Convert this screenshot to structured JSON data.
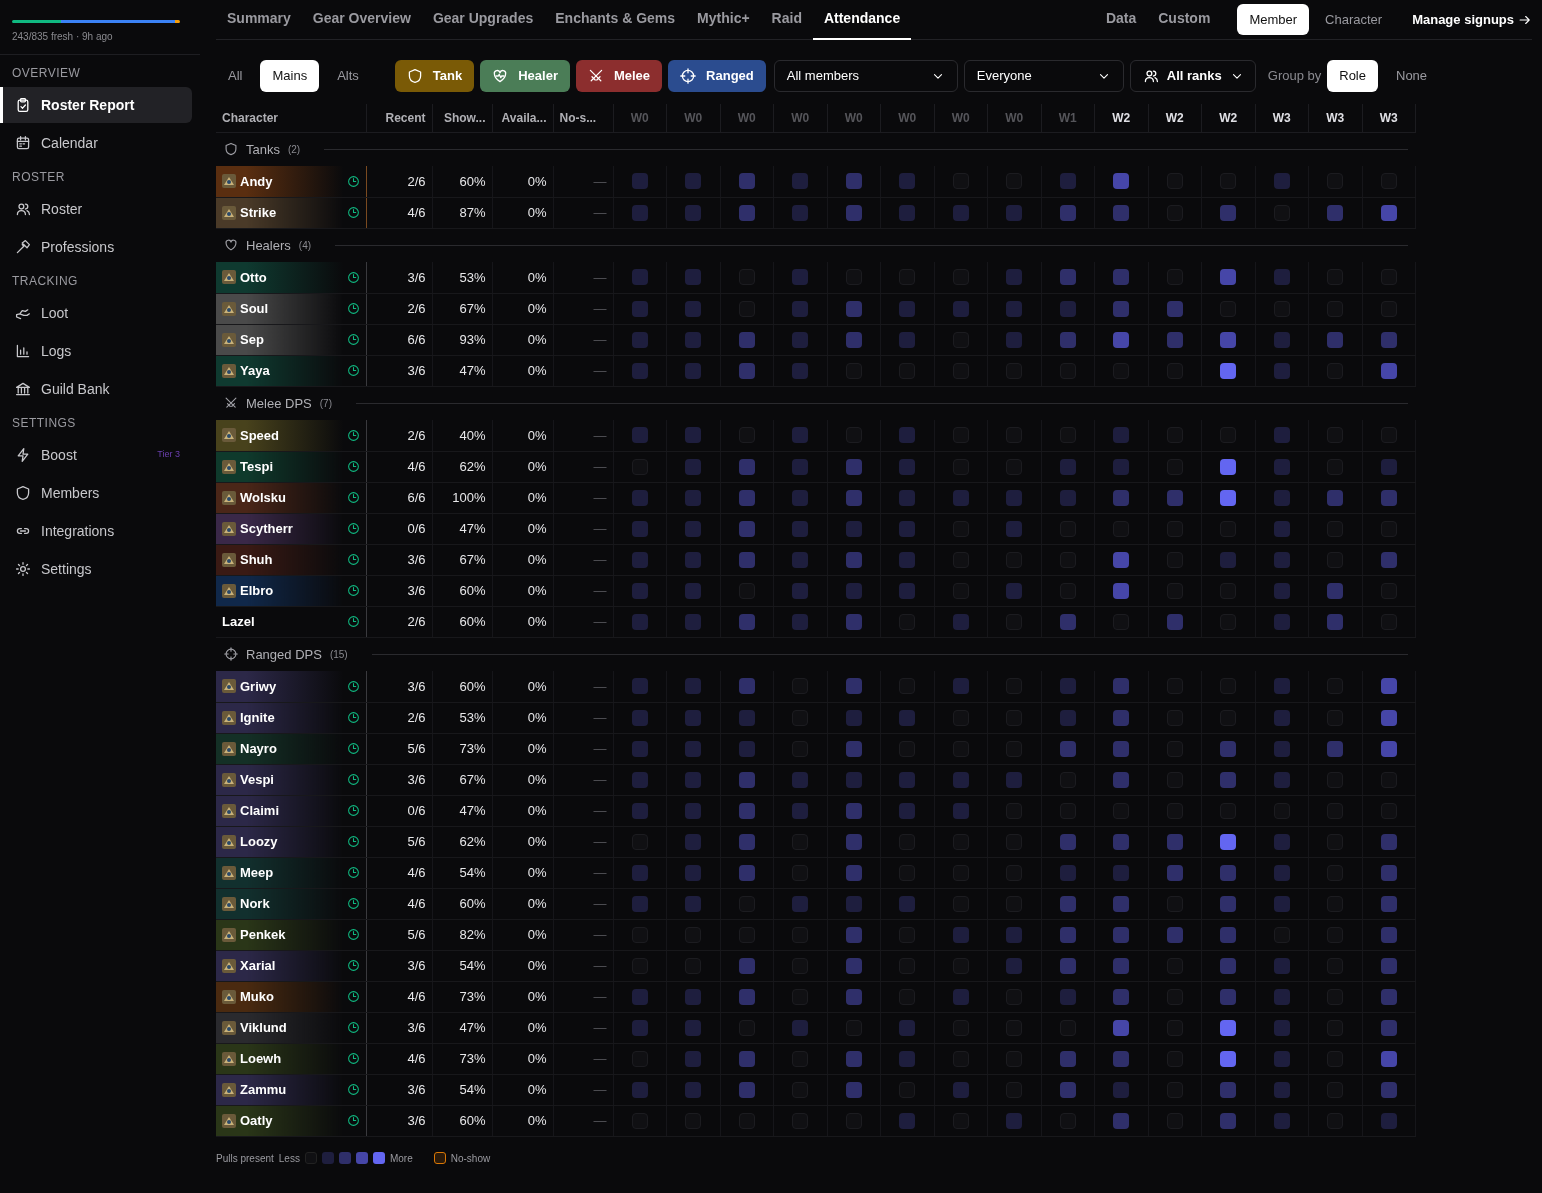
{
  "sidebar": {
    "freshness": {
      "segments": [
        {
          "level": 0.29,
          "color": "#10b981"
        },
        {
          "level": 0.68,
          "color": "#3b82f6"
        },
        {
          "level": 0.03,
          "color": "#f59e0b"
        }
      ],
      "text": "243/835 fresh · 9h ago"
    },
    "sections": [
      {
        "title": "OVERVIEW",
        "items": [
          {
            "label": "Roster Report",
            "selected": true
          },
          {
            "label": "Calendar",
            "selected": false
          }
        ]
      },
      {
        "title": "ROSTER",
        "items": [
          {
            "label": "Roster",
            "selected": false
          },
          {
            "label": "Professions",
            "selected": false
          }
        ]
      },
      {
        "title": "TRACKING",
        "items": [
          {
            "label": "Loot",
            "selected": false
          },
          {
            "label": "Logs",
            "selected": false
          },
          {
            "label": "Guild Bank",
            "selected": false
          }
        ]
      },
      {
        "title": "SETTINGS",
        "items": [
          {
            "label": "Boost",
            "selected": false,
            "badge": "Tier 3"
          },
          {
            "label": "Members",
            "selected": false
          },
          {
            "label": "Integrations",
            "selected": false
          },
          {
            "label": "Settings",
            "selected": false
          }
        ]
      }
    ]
  },
  "tabs": [
    {
      "label": "Summary",
      "selected": false
    },
    {
      "label": "Gear Overview",
      "selected": false
    },
    {
      "label": "Gear Upgrades",
      "selected": false
    },
    {
      "label": "Enchants & Gems",
      "selected": false
    },
    {
      "label": "Mythic+",
      "selected": false
    },
    {
      "label": "Raid",
      "selected": false
    },
    {
      "label": "Attendance",
      "selected": true
    },
    {
      "label": "Data",
      "selected": false
    },
    {
      "label": "Custom",
      "selected": false
    }
  ],
  "view_toggle": [
    {
      "label": "Member",
      "selected": true
    },
    {
      "label": "Character",
      "selected": false
    }
  ],
  "manage_link": "Manage signups",
  "filters": {
    "scope": [
      {
        "label": "All",
        "selected": false
      },
      {
        "label": "Mains",
        "selected": true
      },
      {
        "label": "Alts",
        "selected": false
      }
    ],
    "roles": [
      {
        "label": "Tank",
        "on": true,
        "color": "#7a5a06"
      },
      {
        "label": "Healer",
        "on": true,
        "color": "#4b7d57"
      },
      {
        "label": "Melee",
        "on": true,
        "color": "#8c2e2e"
      },
      {
        "label": "Ranged",
        "on": true,
        "color": "#2b4c8f"
      }
    ],
    "selects": [
      {
        "value": "All members",
        "kind": "plain"
      },
      {
        "value": "Everyone",
        "kind": "plain"
      },
      {
        "value": "All ranks",
        "kind": "people"
      }
    ],
    "group_by_label": "Group by",
    "group_by": [
      {
        "label": "Role",
        "selected": true
      },
      {
        "label": "None",
        "selected": false
      }
    ]
  },
  "table": {
    "columns": [
      "Character",
      "Recent",
      "Show...",
      "Availa...",
      "No-s..."
    ],
    "weeks": [
      {
        "label": "W0",
        "dimmed": true
      },
      {
        "label": "W0",
        "dimmed": true
      },
      {
        "label": "W0",
        "dimmed": true
      },
      {
        "label": "W0",
        "dimmed": true
      },
      {
        "label": "W0",
        "dimmed": true
      },
      {
        "label": "W0",
        "dimmed": true
      },
      {
        "label": "W0",
        "dimmed": true
      },
      {
        "label": "W0",
        "dimmed": true
      },
      {
        "label": "W1",
        "dimmed": true
      },
      {
        "label": "W2",
        "dimmed": false
      },
      {
        "label": "W2",
        "dimmed": false
      },
      {
        "label": "W2",
        "dimmed": false
      },
      {
        "label": "W3",
        "dimmed": false
      },
      {
        "label": "W3",
        "dimmed": false
      },
      {
        "label": "W3",
        "dimmed": false
      }
    ],
    "groups": [
      {
        "kind": "tank",
        "title": "Tanks",
        "count": "(2)",
        "rows": [
          {
            "name": "Andy",
            "color": "#5a2e10",
            "has_icon": true,
            "recent": "2/6",
            "show": "60%",
            "avail": "0%",
            "noshow": "—",
            "cells": [
              {
                "kind": "low"
              },
              {
                "kind": "low"
              },
              {
                "kind": "mid"
              },
              {
                "kind": "low"
              },
              {
                "kind": "mid"
              },
              {
                "kind": "low"
              },
              {
                "kind": "none"
              },
              {
                "kind": "none"
              },
              {
                "kind": "low"
              },
              {
                "kind": "high"
              },
              {
                "kind": "none"
              },
              {
                "kind": "none"
              },
              {
                "kind": "low"
              },
              {
                "kind": "none"
              },
              {
                "kind": "none"
              }
            ]
          },
          {
            "name": "Strike",
            "color": "#4a3a28",
            "has_icon": true,
            "recent": "4/6",
            "show": "87%",
            "avail": "0%",
            "noshow": "—",
            "cells": [
              {
                "kind": "low"
              },
              {
                "kind": "low"
              },
              {
                "kind": "mid"
              },
              {
                "kind": "low"
              },
              {
                "kind": "mid"
              },
              {
                "kind": "low"
              },
              {
                "kind": "low"
              },
              {
                "kind": "low"
              },
              {
                "kind": "mid"
              },
              {
                "kind": "mid"
              },
              {
                "kind": "none"
              },
              {
                "kind": "mid"
              },
              {
                "kind": "none"
              },
              {
                "kind": "mid"
              },
              {
                "kind": "high"
              }
            ]
          }
        ]
      },
      {
        "kind": "healer",
        "title": "Healers",
        "count": "(4)",
        "rows": [
          {
            "name": "Otto",
            "color": "#0f3a30",
            "has_icon": true,
            "recent": "3/6",
            "show": "53%",
            "avail": "0%",
            "noshow": "—",
            "cells": [
              {
                "kind": "low"
              },
              {
                "kind": "low"
              },
              {
                "kind": "none"
              },
              {
                "kind": "low"
              },
              {
                "kind": "none"
              },
              {
                "kind": "none"
              },
              {
                "kind": "none"
              },
              {
                "kind": "low"
              },
              {
                "kind": "mid"
              },
              {
                "kind": "mid"
              },
              {
                "kind": "none"
              },
              {
                "kind": "high"
              },
              {
                "kind": "low"
              },
              {
                "kind": "none"
              },
              {
                "kind": "none"
              }
            ]
          },
          {
            "name": "Soul",
            "color": "#4a4a4a",
            "has_icon": true,
            "recent": "2/6",
            "show": "67%",
            "avail": "0%",
            "noshow": "—",
            "cells": [
              {
                "kind": "low"
              },
              {
                "kind": "low"
              },
              {
                "kind": "none"
              },
              {
                "kind": "low"
              },
              {
                "kind": "mid"
              },
              {
                "kind": "low"
              },
              {
                "kind": "low"
              },
              {
                "kind": "low"
              },
              {
                "kind": "low"
              },
              {
                "kind": "mid"
              },
              {
                "kind": "mid"
              },
              {
                "kind": "none"
              },
              {
                "kind": "none"
              },
              {
                "kind": "none"
              },
              {
                "kind": "none"
              }
            ]
          },
          {
            "name": "Sep",
            "color": "#4a4a4a",
            "has_icon": true,
            "recent": "6/6",
            "show": "93%",
            "avail": "0%",
            "noshow": "—",
            "cells": [
              {
                "kind": "low"
              },
              {
                "kind": "low"
              },
              {
                "kind": "mid"
              },
              {
                "kind": "low"
              },
              {
                "kind": "mid"
              },
              {
                "kind": "low"
              },
              {
                "kind": "none"
              },
              {
                "kind": "low"
              },
              {
                "kind": "mid"
              },
              {
                "kind": "high"
              },
              {
                "kind": "mid"
              },
              {
                "kind": "high"
              },
              {
                "kind": "low"
              },
              {
                "kind": "mid"
              },
              {
                "kind": "mid"
              }
            ]
          },
          {
            "name": "Yaya",
            "color": "#0f3a30",
            "has_icon": true,
            "recent": "3/6",
            "show": "47%",
            "avail": "0%",
            "noshow": "—",
            "cells": [
              {
                "kind": "low"
              },
              {
                "kind": "low"
              },
              {
                "kind": "mid"
              },
              {
                "kind": "low"
              },
              {
                "kind": "none"
              },
              {
                "kind": "none"
              },
              {
                "kind": "none"
              },
              {
                "kind": "none"
              },
              {
                "kind": "none"
              },
              {
                "kind": "none"
              },
              {
                "kind": "none"
              },
              {
                "kind": "max"
              },
              {
                "kind": "low"
              },
              {
                "kind": "none"
              },
              {
                "kind": "high"
              }
            ]
          }
        ]
      },
      {
        "kind": "melee",
        "title": "Melee DPS",
        "count": "(7)",
        "rows": [
          {
            "name": "Speed",
            "color": "#48421c",
            "has_icon": true,
            "recent": "2/6",
            "show": "40%",
            "avail": "0%",
            "noshow": "—",
            "cells": [
              {
                "kind": "low"
              },
              {
                "kind": "low"
              },
              {
                "kind": "none"
              },
              {
                "kind": "low"
              },
              {
                "kind": "none"
              },
              {
                "kind": "low"
              },
              {
                "kind": "none"
              },
              {
                "kind": "none"
              },
              {
                "kind": "none"
              },
              {
                "kind": "low"
              },
              {
                "kind": "none"
              },
              {
                "kind": "none"
              },
              {
                "kind": "low"
              },
              {
                "kind": "none"
              },
              {
                "kind": "none"
              }
            ]
          },
          {
            "name": "Tespi",
            "color": "#0f3a2c",
            "has_icon": true,
            "recent": "4/6",
            "show": "62%",
            "avail": "0%",
            "noshow": "—",
            "cells": [
              {
                "kind": "none"
              },
              {
                "kind": "low"
              },
              {
                "kind": "mid"
              },
              {
                "kind": "low"
              },
              {
                "kind": "mid"
              },
              {
                "kind": "low"
              },
              {
                "kind": "none"
              },
              {
                "kind": "none"
              },
              {
                "kind": "low"
              },
              {
                "kind": "low"
              },
              {
                "kind": "none"
              },
              {
                "kind": "max"
              },
              {
                "kind": "low"
              },
              {
                "kind": "none"
              },
              {
                "kind": "low"
              }
            ]
          },
          {
            "name": "Wolsku",
            "color": "#4a2618",
            "has_icon": true,
            "recent": "6/6",
            "show": "100%",
            "avail": "0%",
            "noshow": "—",
            "cells": [
              {
                "kind": "low"
              },
              {
                "kind": "low"
              },
              {
                "kind": "mid"
              },
              {
                "kind": "low"
              },
              {
                "kind": "mid"
              },
              {
                "kind": "low"
              },
              {
                "kind": "low"
              },
              {
                "kind": "low"
              },
              {
                "kind": "low"
              },
              {
                "kind": "mid"
              },
              {
                "kind": "mid"
              },
              {
                "kind": "max"
              },
              {
                "kind": "low"
              },
              {
                "kind": "mid"
              },
              {
                "kind": "mid"
              }
            ]
          },
          {
            "name": "Scytherr",
            "color": "#3a2848",
            "has_icon": true,
            "recent": "0/6",
            "show": "47%",
            "avail": "0%",
            "noshow": "—",
            "cells": [
              {
                "kind": "low"
              },
              {
                "kind": "low"
              },
              {
                "kind": "mid"
              },
              {
                "kind": "low"
              },
              {
                "kind": "low"
              },
              {
                "kind": "low"
              },
              {
                "kind": "none"
              },
              {
                "kind": "low"
              },
              {
                "kind": "none"
              },
              {
                "kind": "none"
              },
              {
                "kind": "none"
              },
              {
                "kind": "none"
              },
              {
                "kind": "low"
              },
              {
                "kind": "none"
              },
              {
                "kind": "none"
              }
            ]
          },
          {
            "name": "Shuh",
            "color": "#3a1a14",
            "has_icon": true,
            "recent": "3/6",
            "show": "67%",
            "avail": "0%",
            "noshow": "—",
            "cells": [
              {
                "kind": "low"
              },
              {
                "kind": "low"
              },
              {
                "kind": "mid"
              },
              {
                "kind": "low"
              },
              {
                "kind": "mid"
              },
              {
                "kind": "low"
              },
              {
                "kind": "none"
              },
              {
                "kind": "none"
              },
              {
                "kind": "none"
              },
              {
                "kind": "high"
              },
              {
                "kind": "none"
              },
              {
                "kind": "low"
              },
              {
                "kind": "low"
              },
              {
                "kind": "none"
              },
              {
                "kind": "mid"
              }
            ]
          },
          {
            "name": "Elbro",
            "color": "#10284a",
            "has_icon": true,
            "recent": "3/6",
            "show": "60%",
            "avail": "0%",
            "noshow": "—",
            "cells": [
              {
                "kind": "low"
              },
              {
                "kind": "low"
              },
              {
                "kind": "none"
              },
              {
                "kind": "low"
              },
              {
                "kind": "low"
              },
              {
                "kind": "low"
              },
              {
                "kind": "none"
              },
              {
                "kind": "low"
              },
              {
                "kind": "none"
              },
              {
                "kind": "high"
              },
              {
                "kind": "none"
              },
              {
                "kind": "none"
              },
              {
                "kind": "low"
              },
              {
                "kind": "mid"
              },
              {
                "kind": "none"
              }
            ]
          },
          {
            "name": "Lazel",
            "recent": "2/6",
            "show": "60%",
            "avail": "0%",
            "noshow": "—",
            "cells": [
              {
                "kind": "low"
              },
              {
                "kind": "low"
              },
              {
                "kind": "mid"
              },
              {
                "kind": "low"
              },
              {
                "kind": "mid"
              },
              {
                "kind": "none"
              },
              {
                "kind": "low"
              },
              {
                "kind": "none"
              },
              {
                "kind": "mid"
              },
              {
                "kind": "none"
              },
              {
                "kind": "mid"
              },
              {
                "kind": "none"
              },
              {
                "kind": "low"
              },
              {
                "kind": "mid"
              },
              {
                "kind": "none"
              }
            ]
          }
        ]
      },
      {
        "kind": "ranged",
        "title": "Ranged DPS",
        "count": "(15)",
        "rows": [
          {
            "name": "Griwy",
            "color": "#2c2848",
            "has_icon": true,
            "recent": "3/6",
            "show": "60%",
            "avail": "0%",
            "noshow": "—",
            "cells": [
              {
                "kind": "low"
              },
              {
                "kind": "low"
              },
              {
                "kind": "mid"
              },
              {
                "kind": "none"
              },
              {
                "kind": "mid"
              },
              {
                "kind": "none"
              },
              {
                "kind": "low"
              },
              {
                "kind": "none"
              },
              {
                "kind": "low"
              },
              {
                "kind": "mid"
              },
              {
                "kind": "none"
              },
              {
                "kind": "none"
              },
              {
                "kind": "low"
              },
              {
                "kind": "none"
              },
              {
                "kind": "high"
              }
            ]
          },
          {
            "name": "Ignite",
            "color": "#2c2848",
            "has_icon": true,
            "recent": "2/6",
            "show": "53%",
            "avail": "0%",
            "noshow": "—",
            "cells": [
              {
                "kind": "low"
              },
              {
                "kind": "low"
              },
              {
                "kind": "low"
              },
              {
                "kind": "none"
              },
              {
                "kind": "low"
              },
              {
                "kind": "low"
              },
              {
                "kind": "none"
              },
              {
                "kind": "none"
              },
              {
                "kind": "low"
              },
              {
                "kind": "mid"
              },
              {
                "kind": "none"
              },
              {
                "kind": "none"
              },
              {
                "kind": "low"
              },
              {
                "kind": "none"
              },
              {
                "kind": "high"
              }
            ]
          },
          {
            "name": "Nayro",
            "color": "#143026",
            "has_icon": true,
            "recent": "5/6",
            "show": "73%",
            "avail": "0%",
            "noshow": "—",
            "cells": [
              {
                "kind": "low"
              },
              {
                "kind": "low"
              },
              {
                "kind": "low"
              },
              {
                "kind": "none"
              },
              {
                "kind": "mid"
              },
              {
                "kind": "none"
              },
              {
                "kind": "none"
              },
              {
                "kind": "none"
              },
              {
                "kind": "mid"
              },
              {
                "kind": "mid"
              },
              {
                "kind": "none"
              },
              {
                "kind": "mid"
              },
              {
                "kind": "low"
              },
              {
                "kind": "mid"
              },
              {
                "kind": "high"
              }
            ]
          },
          {
            "name": "Vespi",
            "color": "#2c2848",
            "has_icon": true,
            "recent": "3/6",
            "show": "67%",
            "avail": "0%",
            "noshow": "—",
            "cells": [
              {
                "kind": "low"
              },
              {
                "kind": "low"
              },
              {
                "kind": "mid"
              },
              {
                "kind": "low"
              },
              {
                "kind": "low"
              },
              {
                "kind": "low"
              },
              {
                "kind": "low"
              },
              {
                "kind": "low"
              },
              {
                "kind": "none"
              },
              {
                "kind": "mid"
              },
              {
                "kind": "none"
              },
              {
                "kind": "mid"
              },
              {
                "kind": "low"
              },
              {
                "kind": "none"
              },
              {
                "kind": "none"
              }
            ]
          },
          {
            "name": "Claimi",
            "color": "#2c2848",
            "has_icon": true,
            "recent": "0/6",
            "show": "47%",
            "avail": "0%",
            "noshow": "—",
            "cells": [
              {
                "kind": "low"
              },
              {
                "kind": "low"
              },
              {
                "kind": "mid"
              },
              {
                "kind": "low"
              },
              {
                "kind": "mid"
              },
              {
                "kind": "low"
              },
              {
                "kind": "low"
              },
              {
                "kind": "none"
              },
              {
                "kind": "none"
              },
              {
                "kind": "none"
              },
              {
                "kind": "none"
              },
              {
                "kind": "none"
              },
              {
                "kind": "none"
              },
              {
                "kind": "none"
              },
              {
                "kind": "none"
              }
            ]
          },
          {
            "name": "Loozy",
            "color": "#2c2848",
            "has_icon": true,
            "recent": "5/6",
            "show": "62%",
            "avail": "0%",
            "noshow": "—",
            "cells": [
              {
                "kind": "none"
              },
              {
                "kind": "low"
              },
              {
                "kind": "mid"
              },
              {
                "kind": "none"
              },
              {
                "kind": "mid"
              },
              {
                "kind": "none"
              },
              {
                "kind": "none"
              },
              {
                "kind": "none"
              },
              {
                "kind": "mid"
              },
              {
                "kind": "mid"
              },
              {
                "kind": "mid"
              },
              {
                "kind": "max"
              },
              {
                "kind": "low"
              },
              {
                "kind": "none"
              },
              {
                "kind": "mid"
              }
            ]
          },
          {
            "name": "Meep",
            "color": "#12302e",
            "has_icon": true,
            "recent": "4/6",
            "show": "54%",
            "avail": "0%",
            "noshow": "—",
            "cells": [
              {
                "kind": "low"
              },
              {
                "kind": "low"
              },
              {
                "kind": "mid"
              },
              {
                "kind": "none"
              },
              {
                "kind": "mid"
              },
              {
                "kind": "none"
              },
              {
                "kind": "none"
              },
              {
                "kind": "none"
              },
              {
                "kind": "low"
              },
              {
                "kind": "low"
              },
              {
                "kind": "mid"
              },
              {
                "kind": "mid"
              },
              {
                "kind": "low"
              },
              {
                "kind": "none"
              },
              {
                "kind": "mid"
              }
            ]
          },
          {
            "name": "Nork",
            "color": "#12302e",
            "has_icon": true,
            "recent": "4/6",
            "show": "60%",
            "avail": "0%",
            "noshow": "—",
            "cells": [
              {
                "kind": "low"
              },
              {
                "kind": "low"
              },
              {
                "kind": "none"
              },
              {
                "kind": "low"
              },
              {
                "kind": "low"
              },
              {
                "kind": "low"
              },
              {
                "kind": "none"
              },
              {
                "kind": "none"
              },
              {
                "kind": "mid"
              },
              {
                "kind": "mid"
              },
              {
                "kind": "none"
              },
              {
                "kind": "mid"
              },
              {
                "kind": "low"
              },
              {
                "kind": "none"
              },
              {
                "kind": "mid"
              }
            ]
          },
          {
            "name": "Penkek",
            "color": "#2a3618",
            "has_icon": true,
            "recent": "5/6",
            "show": "82%",
            "avail": "0%",
            "noshow": "—",
            "cells": [
              {
                "kind": "none"
              },
              {
                "kind": "none"
              },
              {
                "kind": "none"
              },
              {
                "kind": "none"
              },
              {
                "kind": "mid"
              },
              {
                "kind": "none"
              },
              {
                "kind": "low"
              },
              {
                "kind": "low"
              },
              {
                "kind": "mid"
              },
              {
                "kind": "mid"
              },
              {
                "kind": "mid"
              },
              {
                "kind": "mid"
              },
              {
                "kind": "none"
              },
              {
                "kind": "none"
              },
              {
                "kind": "mid"
              }
            ]
          },
          {
            "name": "Xarial",
            "color": "#2c2848",
            "has_icon": true,
            "recent": "3/6",
            "show": "54%",
            "avail": "0%",
            "noshow": "—",
            "cells": [
              {
                "kind": "none"
              },
              {
                "kind": "none"
              },
              {
                "kind": "mid"
              },
              {
                "kind": "none"
              },
              {
                "kind": "mid"
              },
              {
                "kind": "none"
              },
              {
                "kind": "none"
              },
              {
                "kind": "low"
              },
              {
                "kind": "mid"
              },
              {
                "kind": "mid"
              },
              {
                "kind": "none"
              },
              {
                "kind": "mid"
              },
              {
                "kind": "low"
              },
              {
                "kind": "none"
              },
              {
                "kind": "mid"
              }
            ]
          },
          {
            "name": "Muko",
            "color": "#4a2a10",
            "has_icon": true,
            "recent": "4/6",
            "show": "73%",
            "avail": "0%",
            "noshow": "—",
            "cells": [
              {
                "kind": "low"
              },
              {
                "kind": "low"
              },
              {
                "kind": "mid"
              },
              {
                "kind": "none"
              },
              {
                "kind": "mid"
              },
              {
                "kind": "none"
              },
              {
                "kind": "low"
              },
              {
                "kind": "none"
              },
              {
                "kind": "low"
              },
              {
                "kind": "mid"
              },
              {
                "kind": "none"
              },
              {
                "kind": "mid"
              },
              {
                "kind": "low"
              },
              {
                "kind": "none"
              },
              {
                "kind": "mid"
              }
            ]
          },
          {
            "name": "Viklund",
            "color": "#2a2a2e",
            "has_icon": true,
            "recent": "3/6",
            "show": "47%",
            "avail": "0%",
            "noshow": "—",
            "cells": [
              {
                "kind": "low"
              },
              {
                "kind": "low"
              },
              {
                "kind": "none"
              },
              {
                "kind": "low"
              },
              {
                "kind": "none"
              },
              {
                "kind": "low"
              },
              {
                "kind": "none"
              },
              {
                "kind": "none"
              },
              {
                "kind": "none"
              },
              {
                "kind": "high"
              },
              {
                "kind": "none"
              },
              {
                "kind": "max"
              },
              {
                "kind": "low"
              },
              {
                "kind": "none"
              },
              {
                "kind": "mid"
              }
            ]
          },
          {
            "name": "Loewh",
            "color": "#2a3618",
            "has_icon": true,
            "recent": "4/6",
            "show": "73%",
            "avail": "0%",
            "noshow": "—",
            "cells": [
              {
                "kind": "none"
              },
              {
                "kind": "low"
              },
              {
                "kind": "mid"
              },
              {
                "kind": "none"
              },
              {
                "kind": "mid"
              },
              {
                "kind": "low"
              },
              {
                "kind": "none"
              },
              {
                "kind": "none"
              },
              {
                "kind": "mid"
              },
              {
                "kind": "mid"
              },
              {
                "kind": "none"
              },
              {
                "kind": "max"
              },
              {
                "kind": "low"
              },
              {
                "kind": "none"
              },
              {
                "kind": "high"
              }
            ]
          },
          {
            "name": "Zammu",
            "color": "#2c2848",
            "has_icon": true,
            "recent": "3/6",
            "show": "54%",
            "avail": "0%",
            "noshow": "—",
            "cells": [
              {
                "kind": "low"
              },
              {
                "kind": "low"
              },
              {
                "kind": "mid"
              },
              {
                "kind": "none"
              },
              {
                "kind": "mid"
              },
              {
                "kind": "none"
              },
              {
                "kind": "low"
              },
              {
                "kind": "none"
              },
              {
                "kind": "mid"
              },
              {
                "kind": "low"
              },
              {
                "kind": "none"
              },
              {
                "kind": "mid"
              },
              {
                "kind": "low"
              },
              {
                "kind": "none"
              },
              {
                "kind": "mid"
              }
            ]
          },
          {
            "name": "Oatly",
            "color": "#2a3618",
            "has_icon": true,
            "recent": "3/6",
            "show": "60%",
            "avail": "0%",
            "noshow": "—",
            "cells": [
              {
                "kind": "none"
              },
              {
                "kind": "none"
              },
              {
                "kind": "none"
              },
              {
                "kind": "none"
              },
              {
                "kind": "none"
              },
              {
                "kind": "low"
              },
              {
                "kind": "none"
              },
              {
                "kind": "low"
              },
              {
                "kind": "none"
              },
              {
                "kind": "mid"
              },
              {
                "kind": "none"
              },
              {
                "kind": "mid"
              },
              {
                "kind": "low"
              },
              {
                "kind": "none"
              },
              {
                "kind": "low"
              }
            ]
          }
        ]
      }
    ]
  },
  "legend": {
    "label": "Pulls present",
    "less": "Less",
    "more": "More",
    "noshow": "No-show"
  }
}
